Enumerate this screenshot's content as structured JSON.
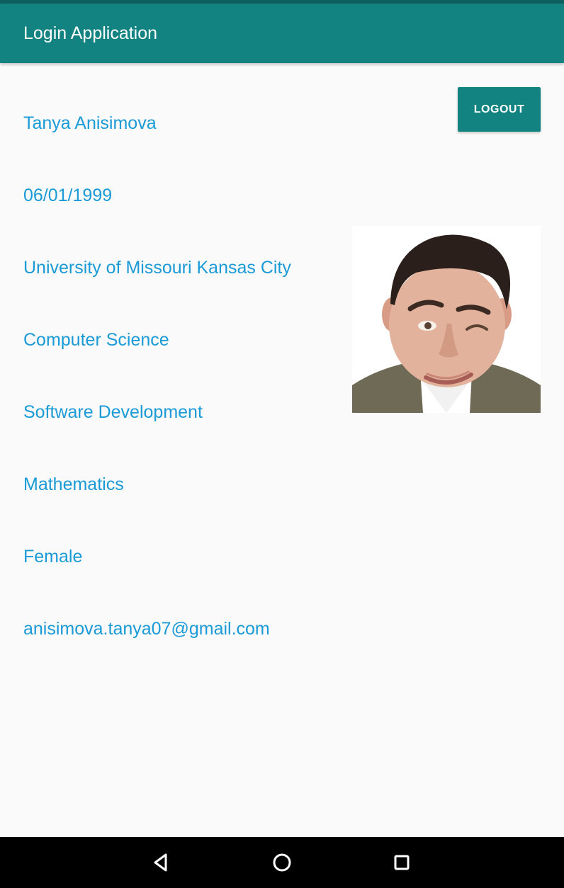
{
  "app_bar": {
    "title": "Login Application"
  },
  "actions": {
    "logout_label": "LOGOUT"
  },
  "profile": {
    "name": "Tanya Anisimova",
    "birth_date": "06/01/1999",
    "university": "University of Missouri Kansas City",
    "major": "Computer Science",
    "focus": "Software Development",
    "minor": "Mathematics",
    "gender": "Female",
    "email": "anisimova.tanya07@gmail.com",
    "photo": "profile-photo"
  },
  "navigation": {
    "back_icon": "triangle-back-icon",
    "home_icon": "circle-home-icon",
    "recents_icon": "square-recents-icon"
  },
  "colors": {
    "app_bar": "#138382",
    "status_bar": "#0e5f5f",
    "text_accent": "#1a9ad6",
    "background": "#fafafa",
    "nav_bar": "#000000"
  }
}
